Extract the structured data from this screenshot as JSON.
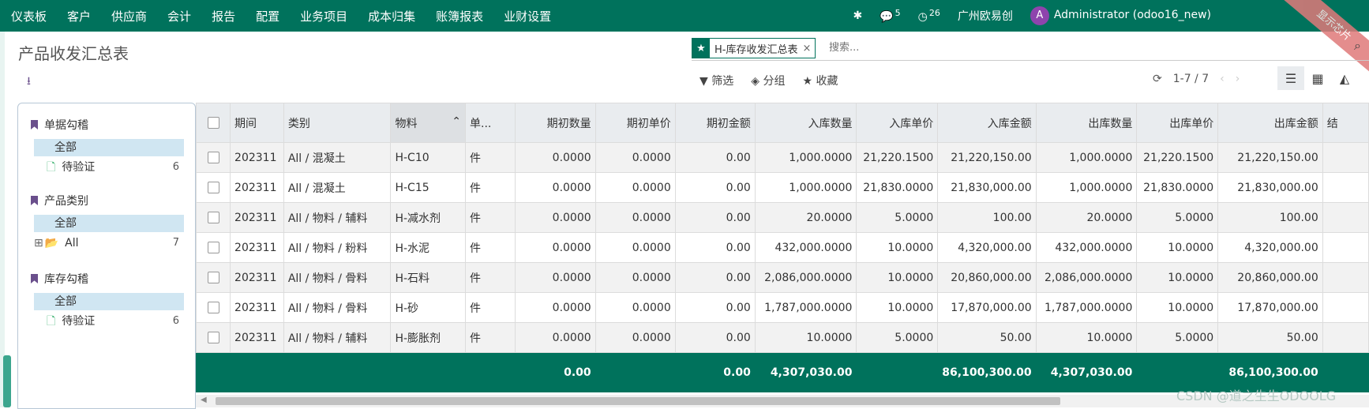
{
  "topbar": {
    "menu": [
      "仪表板",
      "客户",
      "供应商",
      "会计",
      "报告",
      "配置",
      "业务项目",
      "成本归集",
      "账簿报表",
      "业财设置"
    ],
    "messages_count": "5",
    "activity_count": "26",
    "company": "广州欧易创",
    "user_initial": "A",
    "user": "Administrator (odoo16_new)",
    "ribbon": "显示芯片"
  },
  "page": {
    "title": "产品收发汇总表"
  },
  "search": {
    "facet": "H-库存收发汇总表",
    "placeholder": "搜索..."
  },
  "toolbar": {
    "filter": "筛选",
    "group": "分组",
    "favorites": "收藏"
  },
  "pager": {
    "text": "1-7 / 7"
  },
  "sidepanel": {
    "groups": [
      {
        "title": "单据勾稽",
        "selected": "全部",
        "item": "待验证",
        "count": "6"
      },
      {
        "title": "产品类别",
        "selected": "全部",
        "item": "All",
        "count": "7"
      },
      {
        "title": "库存勾稽",
        "selected": "全部",
        "item": "待验证",
        "count": "6"
      }
    ]
  },
  "table": {
    "headers": [
      "期间",
      "类别",
      "物料",
      "单...",
      "期初数量",
      "期初单价",
      "期初金额",
      "入库数量",
      "入库单价",
      "入库金额",
      "出库数量",
      "出库单价",
      "出库金额",
      "结"
    ],
    "rows": [
      [
        "202311",
        "All / 混凝土",
        "H-C10",
        "件",
        "0.0000",
        "0.0000",
        "0.00",
        "1,000.0000",
        "21,220.1500",
        "21,220,150.00",
        "1,000.0000",
        "21,220.1500",
        "21,220,150.00"
      ],
      [
        "202311",
        "All / 混凝土",
        "H-C15",
        "件",
        "0.0000",
        "0.0000",
        "0.00",
        "1,000.0000",
        "21,830.0000",
        "21,830,000.00",
        "1,000.0000",
        "21,830.0000",
        "21,830,000.00"
      ],
      [
        "202311",
        "All / 物料 / 辅料",
        "H-减水剂",
        "件",
        "0.0000",
        "0.0000",
        "0.00",
        "20.0000",
        "5.0000",
        "100.00",
        "20.0000",
        "5.0000",
        "100.00"
      ],
      [
        "202311",
        "All / 物料 / 粉料",
        "H-水泥",
        "件",
        "0.0000",
        "0.0000",
        "0.00",
        "432,000.0000",
        "10.0000",
        "4,320,000.00",
        "432,000.0000",
        "10.0000",
        "4,320,000.00"
      ],
      [
        "202311",
        "All / 物料 / 骨料",
        "H-石料",
        "件",
        "0.0000",
        "0.0000",
        "0.00",
        "2,086,000.0000",
        "10.0000",
        "20,860,000.00",
        "2,086,000.0000",
        "10.0000",
        "20,860,000.00"
      ],
      [
        "202311",
        "All / 物料 / 骨料",
        "H-砂",
        "件",
        "0.0000",
        "0.0000",
        "0.00",
        "1,787,000.0000",
        "10.0000",
        "17,870,000.00",
        "1,787,000.0000",
        "10.0000",
        "17,870,000.00"
      ],
      [
        "202311",
        "All / 物料 / 辅料",
        "H-膨胀剂",
        "件",
        "0.0000",
        "0.0000",
        "0.00",
        "10.0000",
        "5.0000",
        "50.00",
        "10.0000",
        "5.0000",
        "50.00"
      ]
    ],
    "totals": {
      "opening_qty": "0.00",
      "opening_amount": "0.00",
      "in_qty": "4,307,030.00",
      "in_amount": "86,100,300.00",
      "out_qty": "4,307,030.00",
      "out_amount": "86,100,300.00"
    }
  },
  "watermark": "CSDN @道之生生ODOOLG"
}
